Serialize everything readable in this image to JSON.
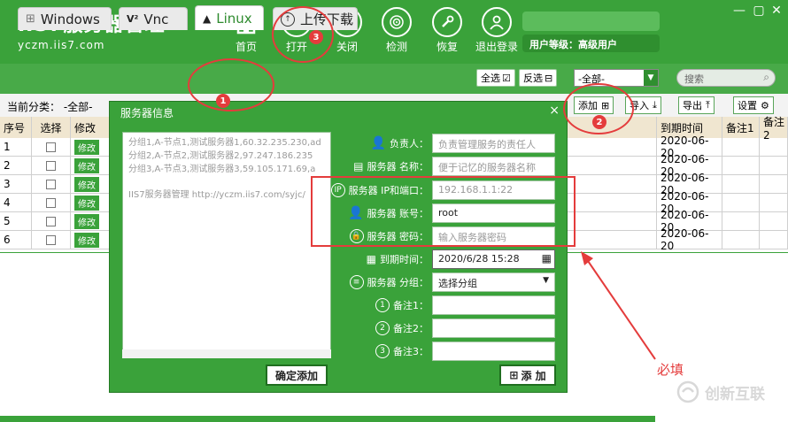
{
  "header": {
    "logo": "IIS7服务器管理",
    "url": "yczm.iis7.com",
    "tools": [
      {
        "label": "首页",
        "icon": "home-icon"
      },
      {
        "label": "打开",
        "icon": "link-icon"
      },
      {
        "label": "关闭",
        "icon": "unlink-icon"
      },
      {
        "label": "检测",
        "icon": "radar-icon"
      },
      {
        "label": "恢复",
        "icon": "wrench-icon"
      },
      {
        "label": "退出登录",
        "icon": "user-icon"
      }
    ],
    "user_level": "用户等级：高级用户"
  },
  "tabs": [
    {
      "label": "Windows",
      "icon": "windows-icon"
    },
    {
      "label": "Vnc",
      "icon": "vnc-icon"
    },
    {
      "label": "Linux",
      "icon": "linux-icon"
    },
    {
      "label": "上传下载",
      "icon": "upload-download-icon"
    }
  ],
  "top_controls": {
    "select_all": "全选",
    "invert": "反选",
    "category_value": "-全部-",
    "search_placeholder": "搜索"
  },
  "toolbar": {
    "category_label": "当前分类：",
    "category_value": "-全部-",
    "add": "添加",
    "import": "导入",
    "export": "导出",
    "settings": "设置"
  },
  "table": {
    "headers": {
      "num": "序号",
      "select": "选择",
      "modify": "修改",
      "expire": "到期时间",
      "note1": "备注1",
      "note2": "备注2"
    },
    "modify_label": "修改",
    "rows": [
      {
        "num": "1",
        "date": "2020-06-20"
      },
      {
        "num": "2",
        "date": "2020-06-20"
      },
      {
        "num": "3",
        "date": "2020-06-20"
      },
      {
        "num": "4",
        "date": "2020-06-20"
      },
      {
        "num": "5",
        "date": "2020-06-20"
      },
      {
        "num": "6",
        "date": "2020-06-20"
      }
    ]
  },
  "dialog": {
    "title": "服务器信息",
    "close": "×",
    "sample_lines": [
      "分组1,A-节点1,测试服务器1,60.32.235.230,ad",
      "分组2,A-节点2,测试服务器2,97.247.186.235",
      "分组3,A-节点3,测试服务器3,59.105.171.69,a"
    ],
    "sample_footer": "IIS7服务器管理 http://yczm.iis7.com/syjc/",
    "fields": {
      "owner": {
        "label": "负责人：",
        "placeholder": "负责管理服务的责任人"
      },
      "name": {
        "label": "服务器 名称：",
        "placeholder": "便于记忆的服务器名称"
      },
      "ip": {
        "label": "服务器 IP和端口：",
        "value": "192.168.1.1:22"
      },
      "account": {
        "label": "服务器 账号：",
        "value": "root"
      },
      "password": {
        "label": "服务器 密码：",
        "placeholder": "输入服务器密码"
      },
      "expire": {
        "label": "到期时间：",
        "value": "2020/6/28 15:28"
      },
      "group": {
        "label": "服务器 分组：",
        "value": "选择分组"
      },
      "note1": {
        "label": "备注1："
      },
      "note2": {
        "label": "备注2："
      },
      "note3": {
        "label": "备注3："
      }
    },
    "confirm_add": "确定添加",
    "add": "添 加"
  },
  "annotations": {
    "b1": "1",
    "b2": "2",
    "b3": "3",
    "note": "必填"
  },
  "watermark": "创新互联",
  "colors": {
    "brand_green": "#3aa23a",
    "annotation_red": "#e43c3c"
  }
}
